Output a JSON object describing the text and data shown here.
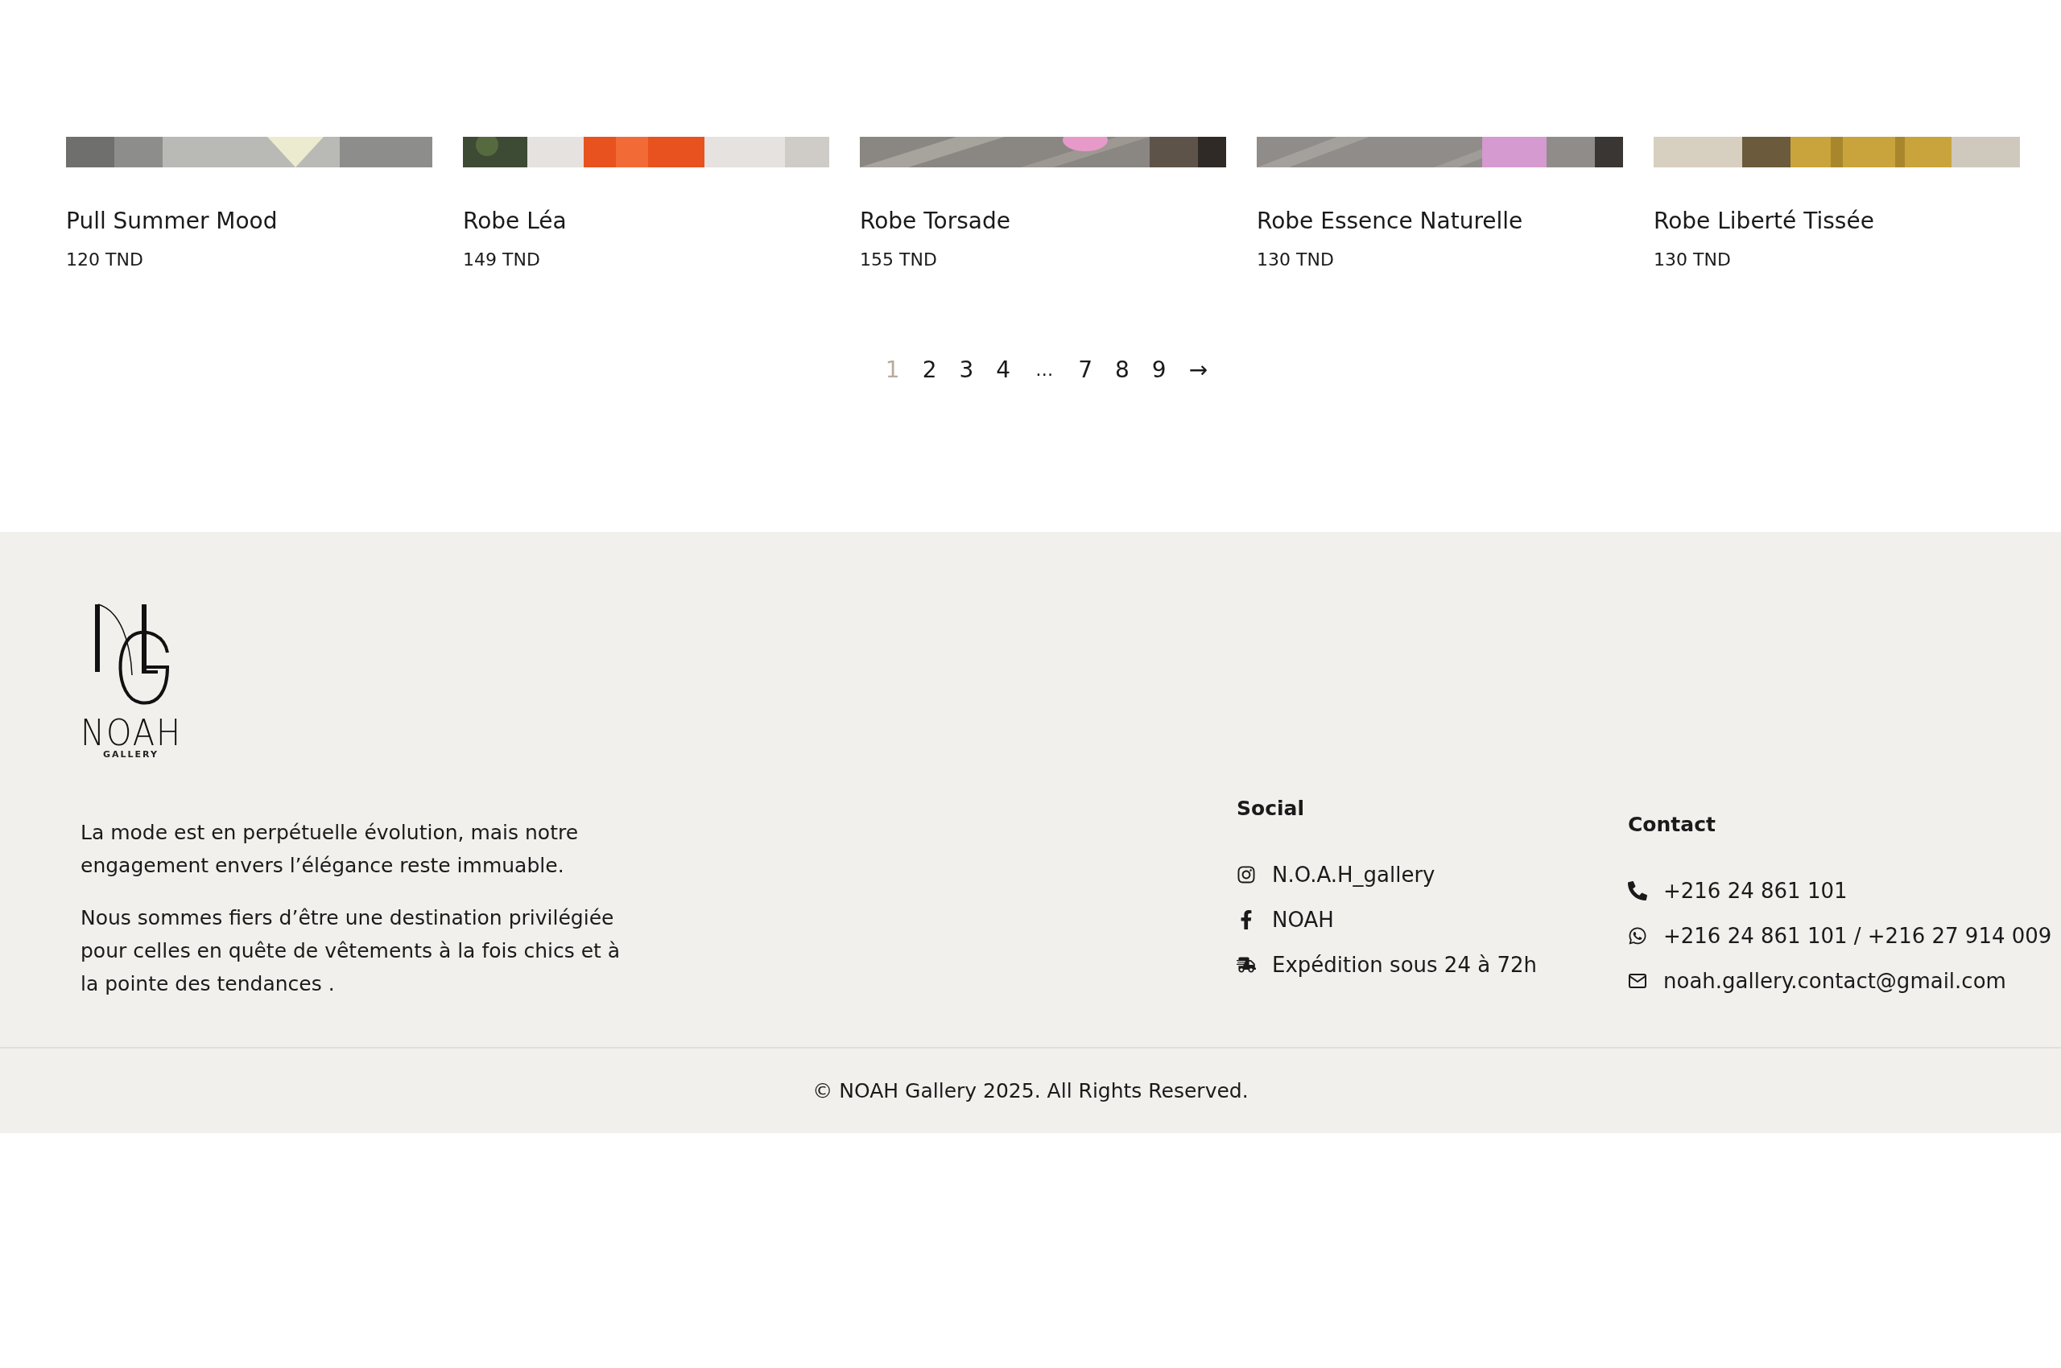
{
  "products": [
    {
      "name": "Pull Summer Mood",
      "price": "120 TND"
    },
    {
      "name": "Robe Léa",
      "price": "149 TND"
    },
    {
      "name": "Robe Torsade",
      "price": "155 TND"
    },
    {
      "name": "Robe Essence Naturelle",
      "price": "130 TND"
    },
    {
      "name": "Robe Liberté Tissée",
      "price": "130 TND"
    }
  ],
  "pagination": [
    {
      "kind": "page",
      "label": "1",
      "selected": true
    },
    {
      "kind": "page",
      "label": "2",
      "selected": false
    },
    {
      "kind": "page",
      "label": "3",
      "selected": false
    },
    {
      "kind": "page",
      "label": "4",
      "selected": false
    },
    {
      "kind": "gap",
      "label": "…"
    },
    {
      "kind": "page",
      "label": "7",
      "selected": false
    },
    {
      "kind": "page",
      "label": "8",
      "selected": false
    },
    {
      "kind": "page",
      "label": "9",
      "selected": false
    },
    {
      "kind": "next",
      "label": "→"
    }
  ],
  "footer": {
    "logo": {
      "name": "NOAH",
      "tagline": "GALLERY"
    },
    "about": [
      "La mode est en perpétuelle évolution, mais notre engagement envers l’élégance reste immuable.",
      "Nous sommes fiers d’être une destination privilégiée pour celles en quête de vêtements à la fois chics et à la pointe des tendances ."
    ],
    "social": {
      "title": "Social",
      "items": [
        {
          "kind": "instagram",
          "label": "N.O.A.H_gallery"
        },
        {
          "kind": "facebook",
          "label": "NOAH"
        },
        {
          "kind": "shipping",
          "label": "Expédition sous 24 à 72h"
        }
      ]
    },
    "contact": {
      "title": "Contact",
      "items": [
        {
          "kind": "phone",
          "label": "+216 24 861 101"
        },
        {
          "kind": "whatsapp",
          "label": "+216 24 861 101 / +216 27 914 009"
        },
        {
          "kind": "email",
          "label": "noah.gallery.contact@gmail.com"
        }
      ]
    },
    "copyright": "© NOAH Gallery 2025. All Rights Reserved."
  }
}
